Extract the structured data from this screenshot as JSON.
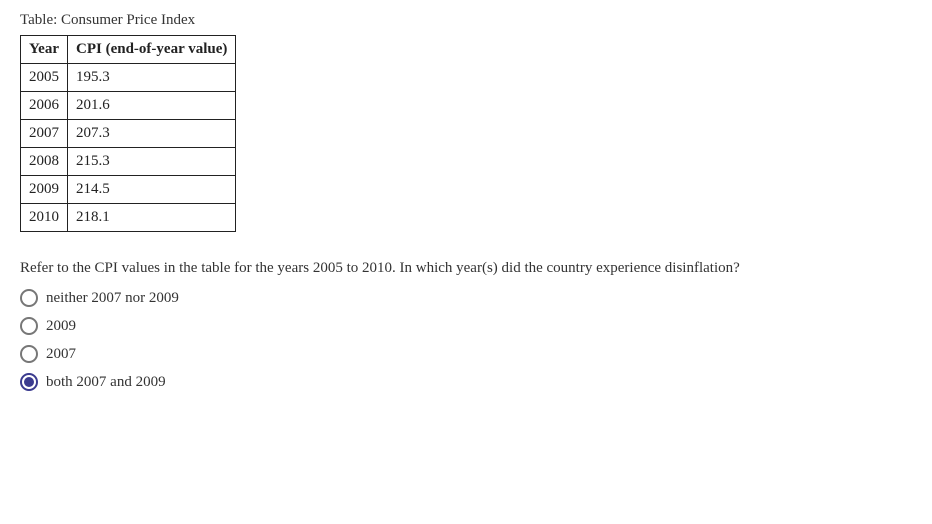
{
  "table": {
    "title": "Table: Consumer Price Index",
    "headers": {
      "col1": "Year",
      "col2": "CPI (end-of-year value)"
    },
    "rows": [
      {
        "year": "2005",
        "cpi": "195.3"
      },
      {
        "year": "2006",
        "cpi": "201.6"
      },
      {
        "year": "2007",
        "cpi": "207.3"
      },
      {
        "year": "2008",
        "cpi": "215.3"
      },
      {
        "year": "2009",
        "cpi": "214.5"
      },
      {
        "year": "2010",
        "cpi": "218.1"
      }
    ]
  },
  "question": {
    "text": "Refer to the CPI values in the table for the years 2005 to 2010. In which year(s) did the country experience disinflation?",
    "options": [
      {
        "label": "neither 2007 nor 2009",
        "selected": false
      },
      {
        "label": "2009",
        "selected": false
      },
      {
        "label": "2007",
        "selected": false
      },
      {
        "label": "both 2007 and 2009",
        "selected": true
      }
    ]
  }
}
